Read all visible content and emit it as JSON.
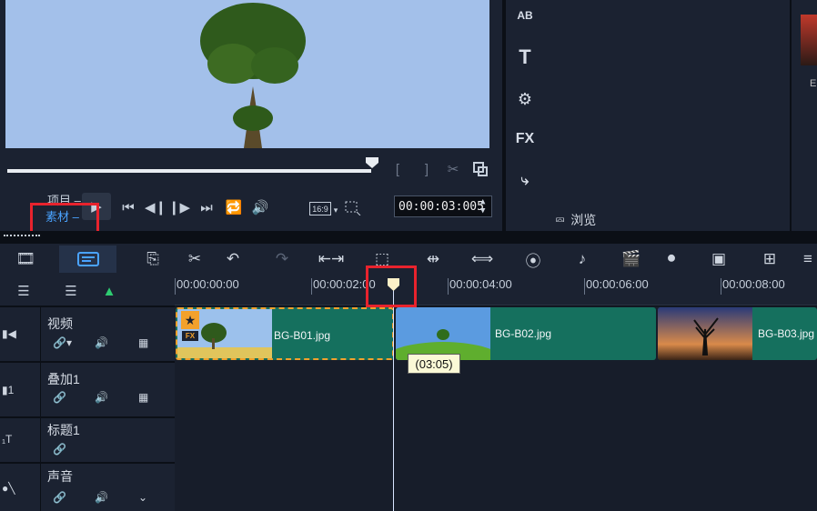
{
  "player": {
    "mode_project": "项目",
    "mode_clip": "素材",
    "timecode": "00:00:03:005",
    "aspect": "16:9",
    "in_mark": "[",
    "out_mark": "]"
  },
  "library": {
    "browse_label": "浏览",
    "thumb_label": "E"
  },
  "tools": {
    "title_ab": "AB",
    "title_t": "T",
    "fx": "FX"
  },
  "ruler": {
    "ticks": [
      "00:00:00:00",
      "00:00:02:00",
      "00:00:04:00",
      "00:00:06:00",
      "00:00:08:00"
    ]
  },
  "tracks": [
    {
      "name": "视频"
    },
    {
      "name": "叠加1"
    },
    {
      "name": "标题1"
    },
    {
      "name": "声音"
    }
  ],
  "clips": [
    {
      "label": "BG-B01.jpg"
    },
    {
      "label": "BG-B02.jpg"
    },
    {
      "label": "BG-B03.jpg"
    }
  ],
  "clip1_badge": "FX",
  "tooltip": "(03:05)",
  "colors": {
    "accent": "#4aa3ff",
    "highlight": "#e8232d",
    "clip": "#15705e",
    "selection_border": "#f2a12b"
  }
}
